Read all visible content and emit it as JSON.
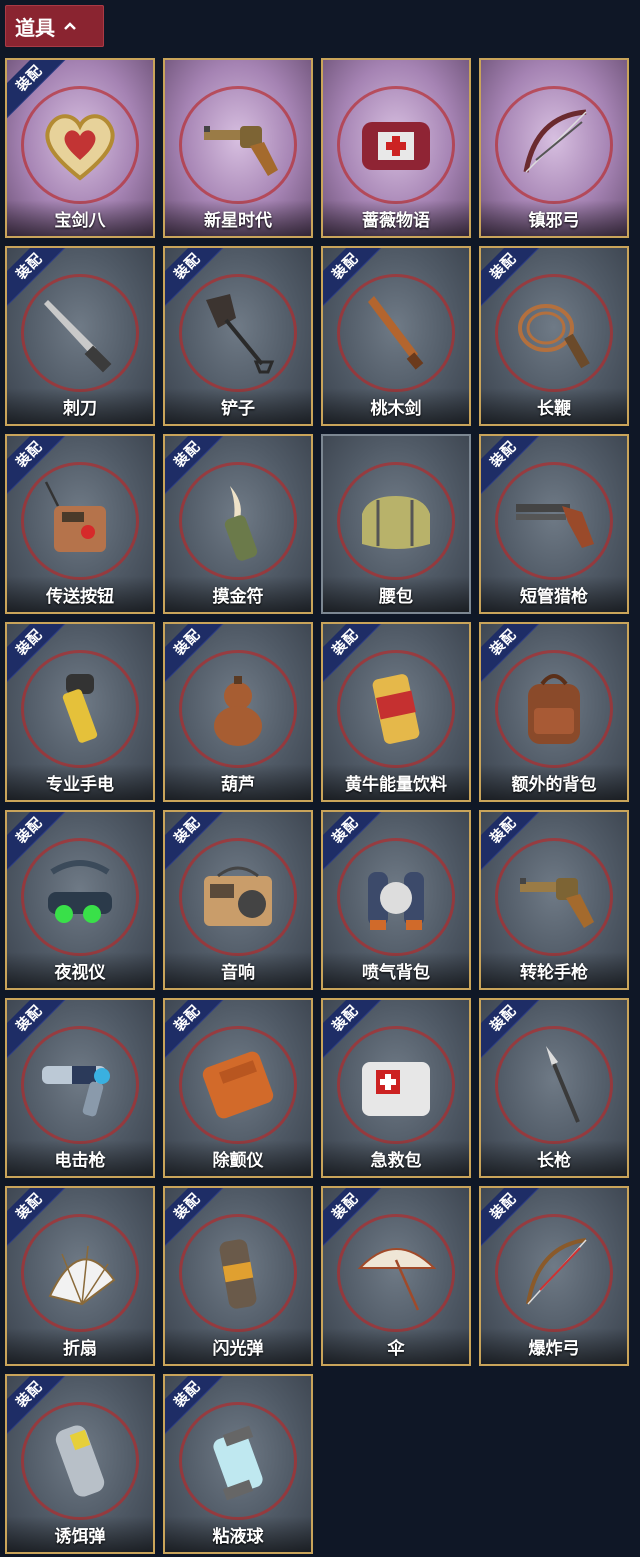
{
  "header": {
    "label": "道具"
  },
  "badge_text": "装配",
  "items": [
    {
      "name": "宝剑八",
      "style": "purple",
      "equipped": true,
      "icon": "heart-emblem-icon"
    },
    {
      "name": "新星时代",
      "style": "purple",
      "equipped": false,
      "icon": "revolver-icon"
    },
    {
      "name": "蔷薇物语",
      "style": "purple",
      "equipped": false,
      "icon": "first-aid-box-icon"
    },
    {
      "name": "镇邪弓",
      "style": "purple",
      "equipped": false,
      "icon": "bow-icon"
    },
    {
      "name": "刺刀",
      "style": "gray",
      "equipped": true,
      "icon": "bayonet-icon"
    },
    {
      "name": "铲子",
      "style": "gray",
      "equipped": true,
      "icon": "shovel-icon"
    },
    {
      "name": "桃木剑",
      "style": "gray",
      "equipped": true,
      "icon": "wooden-sword-icon"
    },
    {
      "name": "长鞭",
      "style": "gray",
      "equipped": true,
      "icon": "whip-icon"
    },
    {
      "name": "传送按钮",
      "style": "gray",
      "equipped": true,
      "icon": "remote-button-icon"
    },
    {
      "name": "摸金符",
      "style": "gray",
      "equipped": true,
      "icon": "talisman-icon"
    },
    {
      "name": "腰包",
      "style": "gray",
      "equipped": false,
      "icon": "waist-bag-icon"
    },
    {
      "name": "短管猎枪",
      "style": "gray",
      "equipped": true,
      "icon": "shotgun-icon"
    },
    {
      "name": "专业手电",
      "style": "gray",
      "equipped": true,
      "icon": "flashlight-icon"
    },
    {
      "name": "葫芦",
      "style": "gray",
      "equipped": true,
      "icon": "gourd-icon"
    },
    {
      "name": "黄牛能量饮料",
      "style": "gray",
      "equipped": true,
      "icon": "energy-drink-icon"
    },
    {
      "name": "额外的背包",
      "style": "gray",
      "equipped": true,
      "icon": "backpack-icon"
    },
    {
      "name": "夜视仪",
      "style": "gray",
      "equipped": true,
      "icon": "night-vision-icon"
    },
    {
      "name": "音响",
      "style": "gray",
      "equipped": true,
      "icon": "radio-icon"
    },
    {
      "name": "喷气背包",
      "style": "gray",
      "equipped": true,
      "icon": "jetpack-icon"
    },
    {
      "name": "转轮手枪",
      "style": "gray",
      "equipped": true,
      "icon": "revolver-icon"
    },
    {
      "name": "电击枪",
      "style": "gray",
      "equipped": true,
      "icon": "stun-gun-icon"
    },
    {
      "name": "除颤仪",
      "style": "gray",
      "equipped": true,
      "icon": "defibrillator-icon"
    },
    {
      "name": "急救包",
      "style": "gray",
      "equipped": true,
      "icon": "first-aid-kit-icon"
    },
    {
      "name": "长枪",
      "style": "gray",
      "equipped": true,
      "icon": "spear-icon"
    },
    {
      "name": "折扇",
      "style": "gray",
      "equipped": true,
      "icon": "folding-fan-icon"
    },
    {
      "name": "闪光弹",
      "style": "gray",
      "equipped": true,
      "icon": "flashbang-icon"
    },
    {
      "name": "伞",
      "style": "gray",
      "equipped": true,
      "icon": "umbrella-icon"
    },
    {
      "name": "爆炸弓",
      "style": "gray",
      "equipped": true,
      "icon": "explosive-bow-icon"
    },
    {
      "name": "诱饵弹",
      "style": "gray",
      "equipped": true,
      "icon": "decoy-grenade-icon"
    },
    {
      "name": "粘液球",
      "style": "gray",
      "equipped": true,
      "icon": "slime-capsule-icon"
    }
  ]
}
